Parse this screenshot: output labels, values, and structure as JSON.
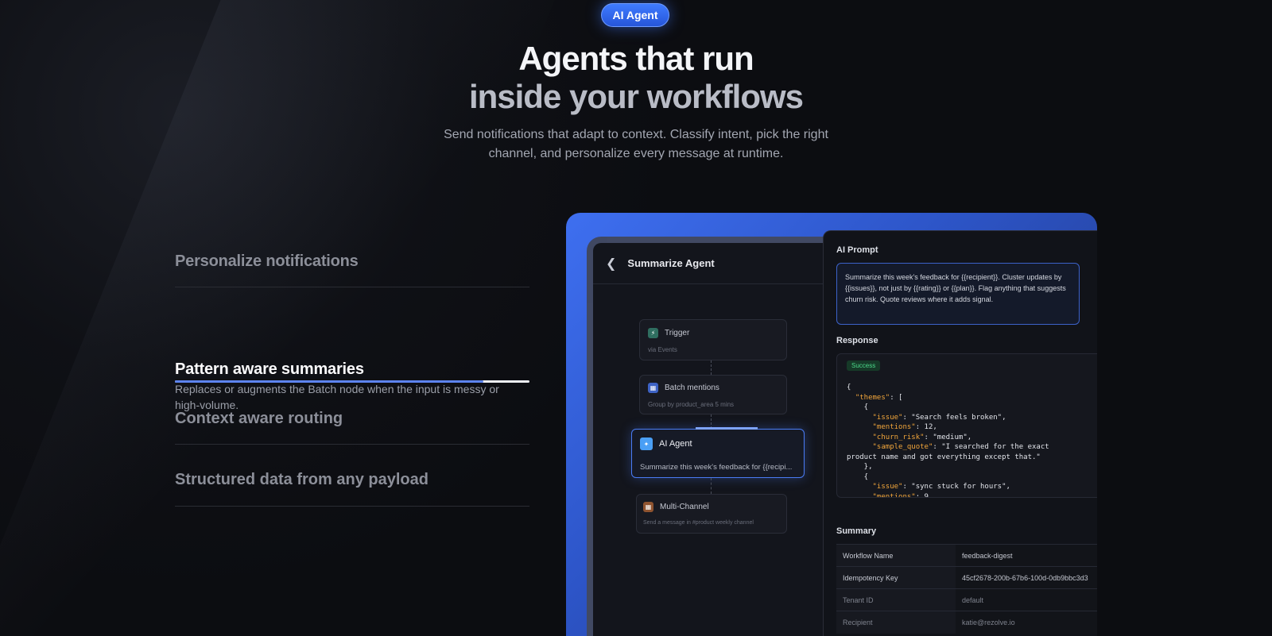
{
  "hero": {
    "badge": "AI Agent",
    "title_line1": "Agents that run",
    "title_line2": "inside your workflows",
    "subtitle": "Send notifications that adapt to context. Classify intent, pick the right channel, and personalize every message at runtime."
  },
  "features": [
    {
      "title": "Personalize notifications"
    },
    {
      "title": "Pattern aware summaries",
      "description": "Replaces or augments the Batch node when the input is messy or high-volume.",
      "active": true,
      "progress_percent": 87
    },
    {
      "title": "Context aware routing"
    },
    {
      "title": "Structured data from any payload"
    }
  ],
  "flow": {
    "header": "Summarize Agent",
    "nodes": [
      {
        "title": "Trigger",
        "subtitle": "via Events",
        "icon": "bolt-icon",
        "color": "#3a8f7a"
      },
      {
        "title": "Batch mentions",
        "subtitle": "Group by product_area 5 mins",
        "icon": "stack-icon",
        "color": "#3d62c4"
      },
      {
        "title": "AI Agent",
        "subtitle": "Summarize this week's feedback for {{recipi...",
        "icon": "sparkle-icon",
        "color": "#4a9ff5"
      },
      {
        "title": "Multi-Channel",
        "subtitle": "Send a message in #product weekly channel",
        "icon": "grid-icon",
        "color": "#b36a3a"
      }
    ]
  },
  "panel": {
    "prompt_label": "AI Prompt",
    "prompt_text": "Summarize this week's feedback for {{recipient}}. Cluster updates by {{issues}}, not just by {{rating}} or {{plan}}. Flag anything that suggests churn risk. Quote reviews where it adds signal.",
    "response_label": "Response",
    "status": "Success",
    "summary_label": "Summary",
    "summary_rows": [
      {
        "key": "Workflow Name",
        "value": "feedback-digest"
      },
      {
        "key": "Idempotency Key",
        "value": "45cf2678-200b-67b6-100d-0db9bbc3d3"
      },
      {
        "key": "Tenant ID",
        "value": "default"
      },
      {
        "key": "Recipient",
        "value": "katie@rezolve.io"
      }
    ]
  },
  "colors": {
    "background": "#0c0d11",
    "accent": "#3f7bff",
    "success": "#4bd88a",
    "json_key": "#f2a63b"
  }
}
